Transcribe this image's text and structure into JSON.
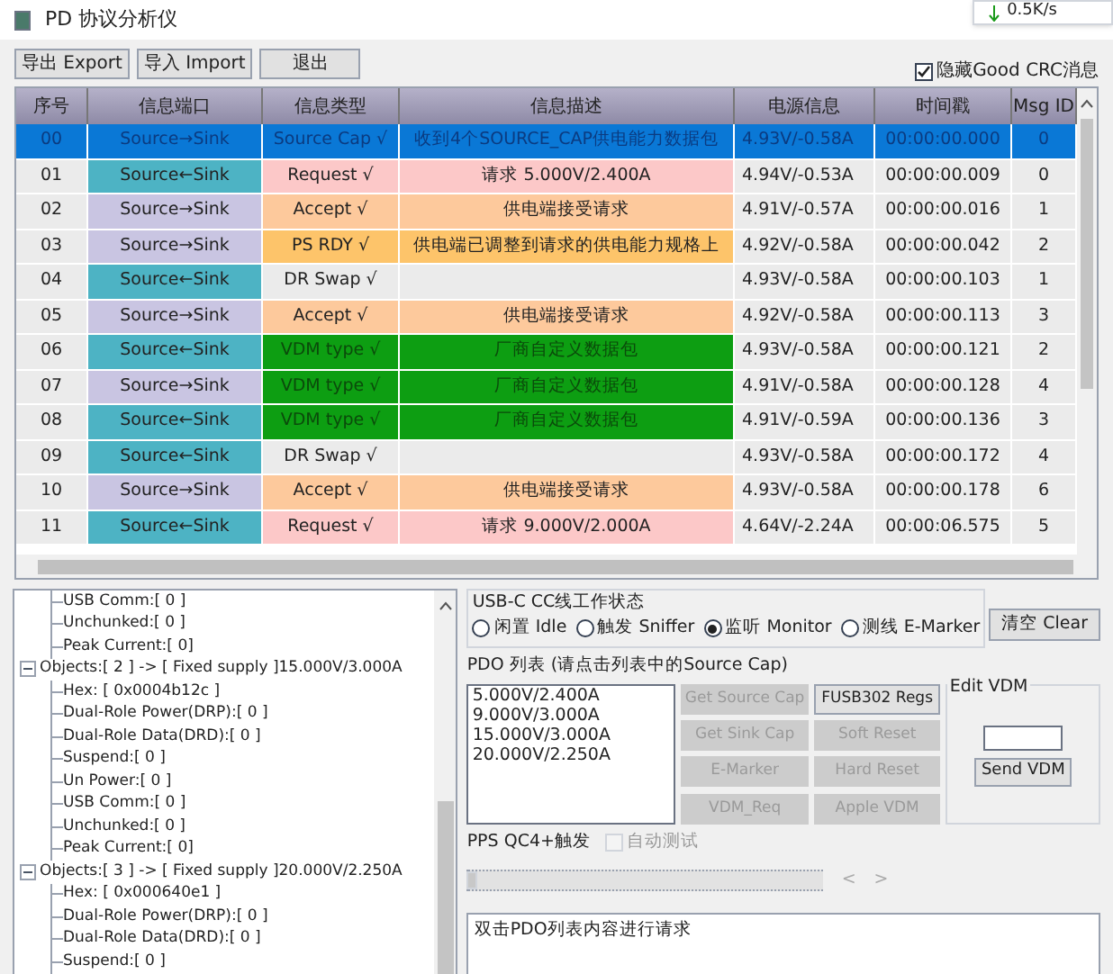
{
  "window": {
    "title": "PD 协议分析仪",
    "net_speed": "0.5K/s"
  },
  "toolbar": {
    "buttons": [
      "导出 Export",
      "导入 Import",
      "退出"
    ],
    "hide_crc": {
      "label": "隐藏Good CRC消息",
      "checked": true
    }
  },
  "table": {
    "columns": [
      "序号",
      "信息端口",
      "信息类型",
      "信息描述",
      "电源信息",
      "时间戳",
      "Msg ID"
    ],
    "rows": [
      {
        "index": "00",
        "port": {
          "text": "Source→Sink"
        },
        "type": {
          "text": "Source Cap √"
        },
        "desc": "收到4个SOURCE_CAP供电能力数据包",
        "power": "4.93V/-0.58A",
        "time": "00:00:00.000",
        "msg_id": "0",
        "selected": true
      },
      {
        "index": "01",
        "port": {
          "text": "Source←Sink",
          "color": "#4db3c4"
        },
        "type": {
          "text": "Request √",
          "color": "#fcc8c8"
        },
        "desc": "请求 5.000V/2.400A",
        "power": "4.94V/-0.53A",
        "time": "00:00:00.009",
        "msg_id": "0",
        "selected": false
      },
      {
        "index": "02",
        "port": {
          "text": "Source→Sink",
          "color": "#c9c5e2"
        },
        "type": {
          "text": "Accept √",
          "color": "#fdc99c"
        },
        "desc": "供电端接受请求",
        "power": "4.91V/-0.57A",
        "time": "00:00:00.016",
        "msg_id": "1",
        "selected": false
      },
      {
        "index": "03",
        "port": {
          "text": "Source→Sink",
          "color": "#c9c5e2"
        },
        "type": {
          "text": "PS RDY √",
          "color": "#fdc46a"
        },
        "desc": "供电端已调整到请求的供电能力规格上",
        "power": "4.92V/-0.58A",
        "time": "00:00:00.042",
        "msg_id": "2",
        "selected": false
      },
      {
        "index": "04",
        "port": {
          "text": "Source←Sink",
          "color": "#4db3c4"
        },
        "type": {
          "text": "DR Swap √"
        },
        "power": "4.93V/-0.58A",
        "time": "00:00:00.103",
        "msg_id": "1",
        "selected": false
      },
      {
        "index": "05",
        "port": {
          "text": "Source→Sink",
          "color": "#c9c5e2"
        },
        "type": {
          "text": "Accept √",
          "color": "#fdc99c"
        },
        "desc": "供电端接受请求",
        "power": "4.92V/-0.58A",
        "time": "00:00:00.113",
        "msg_id": "3",
        "selected": false
      },
      {
        "index": "06",
        "port": {
          "text": "Source←Sink",
          "color": "#4db3c4"
        },
        "type": {
          "text": "VDM type √",
          "color": "#0d9e12"
        },
        "desc": "厂商自定义数据包",
        "power": "4.93V/-0.58A",
        "time": "00:00:00.121",
        "msg_id": "2",
        "selected": false
      },
      {
        "index": "07",
        "port": {
          "text": "Source→Sink",
          "color": "#c9c5e2"
        },
        "type": {
          "text": "VDM type √",
          "color": "#0d9e12"
        },
        "desc": "厂商自定义数据包",
        "power": "4.91V/-0.58A",
        "time": "00:00:00.128",
        "msg_id": "4",
        "selected": false
      },
      {
        "index": "08",
        "port": {
          "text": "Source←Sink",
          "color": "#4db3c4"
        },
        "type": {
          "text": "VDM type √",
          "color": "#0d9e12"
        },
        "desc": "厂商自定义数据包",
        "power": "4.91V/-0.59A",
        "time": "00:00:00.136",
        "msg_id": "3",
        "selected": false
      },
      {
        "index": "09",
        "port": {
          "text": "Source←Sink",
          "color": "#4db3c4"
        },
        "type": {
          "text": "DR Swap √"
        },
        "power": "4.93V/-0.58A",
        "time": "00:00:00.172",
        "msg_id": "4",
        "selected": false
      },
      {
        "index": "10",
        "port": {
          "text": "Source→Sink",
          "color": "#c9c5e2"
        },
        "type": {
          "text": "Accept √",
          "color": "#fdc99c"
        },
        "desc": "供电端接受请求",
        "power": "4.93V/-0.58A",
        "time": "00:00:00.178",
        "msg_id": "6",
        "selected": false
      },
      {
        "index": "11",
        "port": {
          "text": "Source←Sink",
          "color": "#4db3c4"
        },
        "type": {
          "text": "Request √",
          "color": "#fcc8c8"
        },
        "desc": "请求 9.000V/2.000A",
        "power": "4.64V/-2.24A",
        "time": "00:00:06.575",
        "msg_id": "5",
        "selected": false
      }
    ]
  },
  "tree": [
    {
      "children": [
        {
          "label": "USB Comm:[ 0 ]"
        },
        {
          "label": "Unchunked:[ 0 ]"
        },
        {
          "label": "Peak Current:[  0]"
        }
      ]
    },
    {
      "label": "Objects:[ 2 ] -> [ Fixed supply ]15.000V/3.000A",
      "expanded": true,
      "children": [
        {
          "label": "Hex: [ 0x0004b12c ]"
        },
        {
          "label": "Dual-Role Power(DRP):[ 0 ]"
        },
        {
          "label": "Dual-Role Data(DRD):[ 0 ]"
        },
        {
          "label": "Suspend:[ 0 ]"
        },
        {
          "label": "Un Power:[ 0 ]"
        },
        {
          "label": "USB Comm:[ 0 ]"
        },
        {
          "label": "Unchunked:[ 0 ]"
        },
        {
          "label": "Peak Current:[  0]"
        }
      ]
    },
    {
      "label": "Objects:[ 3 ] -> [ Fixed supply ]20.000V/2.250A",
      "expanded": true,
      "children": [
        {
          "label": "Hex: [ 0x000640e1 ]"
        },
        {
          "label": "Dual-Role Power(DRP):[ 0 ]"
        },
        {
          "label": "Dual-Role Data(DRD):[ 0 ]"
        },
        {
          "label": "Suspend:[ 0 ]"
        }
      ]
    }
  ],
  "cc_state": {
    "title": "USB-C CC线工作状态",
    "options": [
      {
        "label": "闲置 Idle",
        "selected": false
      },
      {
        "label": "触发 Sniffer",
        "selected": false
      },
      {
        "label": "监听 Monitor",
        "selected": true
      },
      {
        "label": "测线 E-Marker",
        "selected": false
      }
    ]
  },
  "clear_button": "清空 Clear",
  "pdo": {
    "title": "PDO 列表 (请点击列表中的Source Cap)",
    "items": [
      "5.000V/2.400A",
      "9.000V/3.000A",
      "15.000V/3.000A",
      "20.000V/2.250A"
    ]
  },
  "actions": [
    {
      "label": "Get Source Cap",
      "disabled": true
    },
    {
      "label": "FUSB302 Regs",
      "disabled": false
    },
    {
      "label": "Get Sink Cap",
      "disabled": true
    },
    {
      "label": "Soft Reset",
      "disabled": true
    },
    {
      "label": "E-Marker",
      "disabled": true
    },
    {
      "label": "Hard Reset",
      "disabled": true
    },
    {
      "label": "VDM_Req",
      "disabled": true
    },
    {
      "label": "Apple VDM",
      "disabled": true
    }
  ],
  "edit_vdm": {
    "title": "Edit VDM",
    "button": "Send VDM"
  },
  "pps": {
    "label": "PPS QC4+触发",
    "auto_test": {
      "label": "自动测试",
      "checked": false,
      "disabled": true
    },
    "level": 0.0,
    "prev": "<",
    "next": ">"
  },
  "log": "双击PDO列表内容进行请求"
}
